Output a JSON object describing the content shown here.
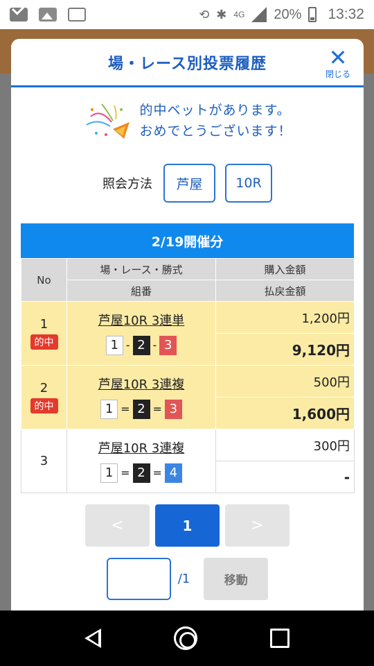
{
  "status_bar": {
    "network": "4G",
    "battery": "20%",
    "time": "13:32"
  },
  "modal": {
    "title": "場・レース別投票履歴",
    "close_label": "閉じる",
    "congrats_line1": "的中ベットがあります。",
    "congrats_line2": "おめでとうございます！",
    "query_label": "照会方法",
    "query_venue": "芦屋",
    "query_race": "10R",
    "date_header": "2/19開催分",
    "table_headers": {
      "no": "No",
      "race_type": "場・レース・勝式",
      "combination": "組番",
      "purchase": "購入金額",
      "payout": "払戻金額"
    },
    "hit_label": "的中",
    "rows": [
      {
        "no": "1",
        "race": "芦屋10R 3連単",
        "combo": [
          "1",
          "2",
          "3"
        ],
        "sep": "-",
        "purchase": "1,200円",
        "payout": "9,120円"
      },
      {
        "no": "2",
        "race": "芦屋10R 3連複",
        "combo": [
          "1",
          "2",
          "3"
        ],
        "sep": "=",
        "purchase": "500円",
        "payout": "1,600円"
      },
      {
        "no": "3",
        "race": "芦屋10R 3連複",
        "combo": [
          "1",
          "2",
          "4"
        ],
        "sep": "=",
        "purchase": "300円",
        "payout": "-"
      }
    ],
    "pagination": {
      "prev": "<",
      "current": "1",
      "next": ">",
      "total": "/1",
      "jump_label": "移動"
    }
  },
  "colors": {
    "accent": "#1e6fd9",
    "hit_row": "#fbeba5",
    "hit_badge": "#e43a2c"
  }
}
